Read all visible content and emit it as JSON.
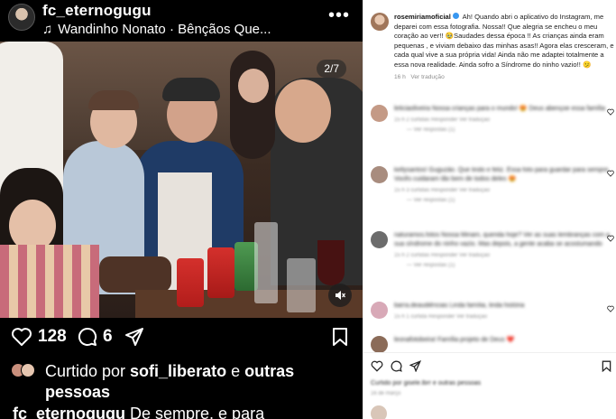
{
  "post": {
    "username": "fc_eternogugu",
    "music": "Wandinho Nonato · Bênçãos Que...",
    "music_icon": "music-note-icon",
    "more_icon": "more-horizontal-icon",
    "photo_counter": "2/7",
    "like_count": "128",
    "comment_count": "6",
    "liked_by_prefix": "Curtido por ",
    "liked_by_user": "sofi_liberato",
    "liked_by_mid": " e ",
    "liked_by_rest": "outras pessoas",
    "caption_user": "fc_eternogugu",
    "caption_text": " De sempre, e para"
  },
  "comment_panel": {
    "author": "rosemiriamoficial",
    "text": "Ah! Quando abri o aplicativo do Instagram, me deparei com essa fotografia. Nossa!! Que alegria se encheu o meu coração ao ver!! 🥹Saudades dessa época !! As crianças ainda eram pequenas , e viviam debaixo das minhas asas!! Agora elas cresceram, e cada qual vive a sua própria vida! Ainda não me adaptei totalmente a essa nova realidade. Ainda sofro a Síndrome do ninho vazio!! 🫤",
    "time": "16 h",
    "translate": "Ver tradução",
    "colors": {
      "accent": "#3897f0",
      "muted": "#8e8e8e",
      "like_red": "#ed4956"
    }
  },
  "comments": [
    {
      "text": "leticiaoliveira Nossa crianças para o mundo! 😍 Deus abençoe essa família",
      "meta": "15 h   2 curtidas   Responder   Ver tradução",
      "replies": "— Ver respostas (1)",
      "avatar_color": "#c49a86"
    },
    {
      "text": "kellysantos! Guguzão. Que lindo e feliz. Essa foto para guardar para sempre. Vocês cuidaram tão bem de todos deles 😍",
      "meta": "15 h   3 curtidas   Responder   Ver tradução",
      "replies": "— Ver respostas (1)",
      "avatar_color": "#a88c7e"
    },
    {
      "text": "naturamos.fotos Nossa Miriam, querida hoje? Ver as suas lembranças com a sua síndrome do ninho vazio. Mas depois, a gente acaba se acostumando",
      "meta": "15 h   2 curtidas   Responder   Ver tradução",
      "replies": "— Ver respostas (1)",
      "avatar_color": "#6c6c6c"
    },
    {
      "text": "barra.deaudiências Linda família, linda história",
      "meta": "15 h   1 curtida   Responder   Ver tradução",
      "replies": "",
      "avatar_color": "#d8a9b7"
    },
    {
      "text": "leonafotobeira! Família projeto de Deus ❤️",
      "meta": "",
      "replies": "",
      "avatar_color": "#8b6b58"
    }
  ],
  "bottom_bar": {
    "liked_by": "Curtido por gisele.lbrr e outras pessoas",
    "date": "16 de março"
  }
}
